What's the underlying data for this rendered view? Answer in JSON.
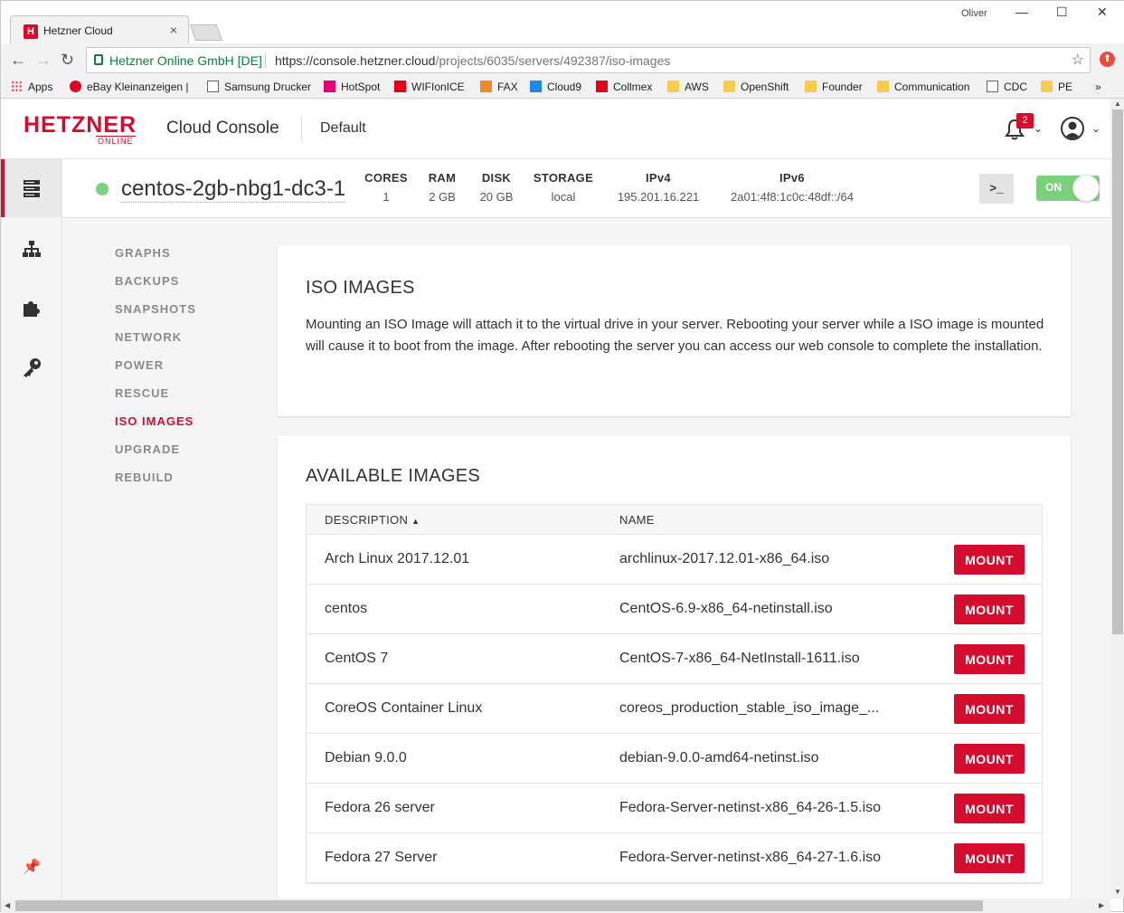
{
  "browser": {
    "tab_title": "Hetzner Cloud",
    "user_label": "Oliver",
    "ev_cert": "Hetzner Online GmbH [DE]",
    "url_host": "https://console.hetzner.cloud",
    "url_path": "/projects/6035/servers/492387/iso-images",
    "bookmarks": [
      "Apps",
      "eBay Kleinanzeigen |",
      "Samsung Drucker",
      "HotSpot",
      "WIFIonICE",
      "FAX",
      "Cloud9",
      "Collmex",
      "AWS",
      "OpenShift",
      "Founder",
      "Communication",
      "CDC",
      "PE",
      "»"
    ]
  },
  "header": {
    "logo_big": "HETZNER",
    "logo_small": "ONLINE",
    "app_title": "Cloud Console",
    "project": "Default",
    "notification_count": "2"
  },
  "server": {
    "name": "centos-2gb-nbg1-dc3-1",
    "status_color": "#7ed17e",
    "specs": [
      {
        "label": "CORES",
        "value": "1"
      },
      {
        "label": "RAM",
        "value": "2 GB"
      },
      {
        "label": "DISK",
        "value": "20 GB"
      },
      {
        "label": "STORAGE",
        "value": "local"
      },
      {
        "label": "IPv4",
        "value": "195.201.16.221"
      },
      {
        "label": "IPv6",
        "value": "2a01:4f8:1c0c:48df::/64"
      }
    ],
    "console_label": ">_",
    "power_label": "ON"
  },
  "submenu": [
    "GRAPHS",
    "BACKUPS",
    "SNAPSHOTS",
    "NETWORK",
    "POWER",
    "RESCUE",
    "ISO IMAGES",
    "UPGRADE",
    "REBUILD"
  ],
  "iso_card": {
    "title": "ISO IMAGES",
    "text": "Mounting an ISO Image will attach it to the virtual drive in your server. Rebooting your server while a ISO image is mounted will cause it to boot from the image. After rebooting the server you can access our web console to complete the installation."
  },
  "images": {
    "title": "AVAILABLE IMAGES",
    "col_description": "DESCRIPTION",
    "col_name": "NAME",
    "sort_icon": "▲",
    "mount_label": "MOUNT",
    "rows": [
      {
        "description": "Arch Linux 2017.12.01",
        "name": "archlinux-2017.12.01-x86_64.iso"
      },
      {
        "description": "centos",
        "name": "CentOS-6.9-x86_64-netinstall.iso"
      },
      {
        "description": "CentOS 7",
        "name": "CentOS-7-x86_64-NetInstall-1611.iso"
      },
      {
        "description": "CoreOS Container Linux",
        "name": "coreos_production_stable_iso_image_..."
      },
      {
        "description": "Debian 9.0.0",
        "name": "debian-9.0.0-amd64-netinst.iso"
      },
      {
        "description": "Fedora 26 server",
        "name": "Fedora-Server-netinst-x86_64-26-1.5.iso"
      },
      {
        "description": "Fedora 27 Server",
        "name": "Fedora-Server-netinst-x86_64-27-1.6.iso"
      }
    ]
  },
  "colors": {
    "brand": "#d50c2d",
    "on": "#7bd17b"
  }
}
